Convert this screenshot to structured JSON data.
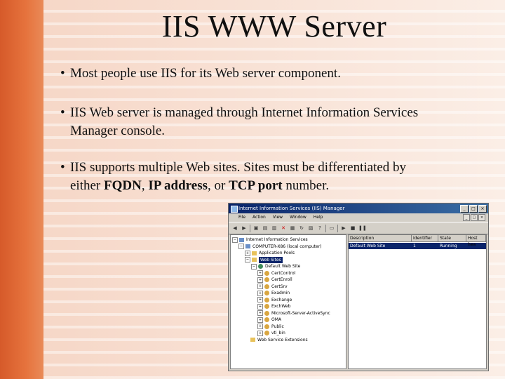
{
  "slide": {
    "title": "IIS WWW Server",
    "bullets": [
      {
        "text": "Most people use IIS for its Web server component."
      },
      {
        "line1": "IIS Web server is managed through Internet Information Services",
        "line2": "Manager console."
      },
      {
        "line1": "IIS supports multiple Web sites. Sites must be differentiated by",
        "line2_prefix": "either ",
        "fqdn": "FQDN",
        "sep1": ", ",
        "ip": "IP address",
        "sep2": ", or ",
        "tcp": "TCP port",
        "suffix": " number."
      }
    ]
  },
  "window": {
    "title": "Internet Information Services (IIS) Manager",
    "menu": [
      "File",
      "Action",
      "View",
      "Window",
      "Help"
    ],
    "tree": [
      {
        "label": "Internet Information Services",
        "level": 0,
        "expander": "−",
        "icon": "computer-icon"
      },
      {
        "label": "COMPUTER-X86 (local computer)",
        "level": 1,
        "expander": "−",
        "icon": "computer-icon"
      },
      {
        "label": "Application Pools",
        "level": 2,
        "expander": "+",
        "icon": "folder-icon"
      },
      {
        "label": "Web Sites",
        "level": 2,
        "expander": "−",
        "icon": "folder-icon",
        "selected": true
      },
      {
        "label": "Default Web Site",
        "level": 3,
        "expander": "−",
        "icon": "globe-icon"
      },
      {
        "label": "CertControl",
        "level": 4,
        "expander": "+",
        "icon": "gear-icon"
      },
      {
        "label": "CertEnroll",
        "level": 4,
        "expander": "+",
        "icon": "gear-icon"
      },
      {
        "label": "CertSrv",
        "level": 4,
        "expander": "+",
        "icon": "gear-icon"
      },
      {
        "label": "Exadmin",
        "level": 4,
        "expander": "+",
        "icon": "gear-icon"
      },
      {
        "label": "Exchange",
        "level": 4,
        "expander": "+",
        "icon": "gear-icon"
      },
      {
        "label": "ExchWeb",
        "level": 4,
        "expander": "+",
        "icon": "gear-icon"
      },
      {
        "label": "Microsoft-Server-ActiveSync",
        "level": 4,
        "expander": "+",
        "icon": "gear-icon"
      },
      {
        "label": "OMA",
        "level": 4,
        "expander": "+",
        "icon": "gear-icon"
      },
      {
        "label": "Public",
        "level": 4,
        "expander": "+",
        "icon": "gear-icon"
      },
      {
        "label": "vti_bin",
        "level": 4,
        "expander": "+",
        "icon": "gear-icon"
      },
      {
        "label": "Web Service Extensions",
        "level": 2,
        "expander": "",
        "icon": "folder-icon"
      }
    ],
    "list_headers": [
      "Description",
      "Identifier",
      "State",
      "Host hea"
    ],
    "list_rows": [
      {
        "description": "Default Web Site",
        "identifier": "1",
        "state": "Running",
        "host": ""
      }
    ]
  }
}
